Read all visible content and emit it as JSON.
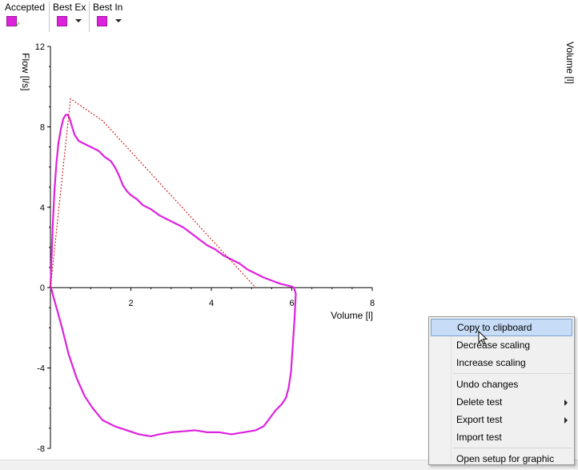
{
  "legend": {
    "items": [
      {
        "label": "Accepted",
        "color": "#dd22dd",
        "icon": "checkmark-icon"
      },
      {
        "label": "Best Ex",
        "color": "#dd22dd",
        "icon": "dropdown-arrow-icon"
      },
      {
        "label": "Best In",
        "color": "#dd22dd",
        "icon": "dropdown-arrow-icon"
      }
    ]
  },
  "right_axis_label": "Volume [l]",
  "chart_data": {
    "type": "line",
    "xlabel": "Volume [l]",
    "ylabel": "Flow [l/s]",
    "xlim": [
      0,
      8
    ],
    "ylim": [
      -8,
      12
    ],
    "x_ticks": [
      "2",
      "4",
      "6",
      "8"
    ],
    "y_ticks": [
      "12",
      "8",
      "4",
      "0",
      "-4",
      "-8"
    ],
    "grid": false,
    "series": [
      {
        "style": "solid",
        "color": "#dd22dd",
        "x": [
          0,
          0.03,
          0.06,
          0.1,
          0.15,
          0.2,
          0.26,
          0.32,
          0.38,
          0.43,
          0.48,
          0.54,
          0.6,
          0.7,
          0.8,
          0.9,
          1.0,
          1.2,
          1.35,
          1.5,
          1.6,
          1.7,
          1.8,
          1.9,
          2.0,
          2.15,
          2.3,
          2.5,
          2.7,
          2.9,
          3.1,
          3.3,
          3.5,
          3.7,
          3.9,
          4.1,
          4.3,
          4.5,
          4.7,
          4.9,
          5.1,
          5.3,
          5.5,
          5.7,
          5.9,
          6.0,
          6.05,
          6.1,
          6.07,
          6.02,
          5.98,
          5.92,
          5.85,
          5.75,
          5.6,
          5.45,
          5.3,
          5.1,
          4.8,
          4.5,
          4.2,
          3.9,
          3.6,
          3.3,
          3.0,
          2.7,
          2.5,
          2.2,
          1.9,
          1.6,
          1.3,
          1.05,
          0.85,
          0.65,
          0.45,
          0.3,
          0.18,
          0.08,
          0.03,
          0
        ],
        "y": [
          0,
          1.6,
          3.2,
          4.8,
          6.2,
          7.2,
          7.9,
          8.4,
          8.6,
          8.6,
          8.4,
          8.0,
          7.6,
          7.3,
          7.2,
          7.1,
          7.0,
          6.8,
          6.5,
          6.3,
          6.0,
          5.6,
          5.1,
          4.8,
          4.6,
          4.4,
          4.1,
          3.9,
          3.6,
          3.4,
          3.2,
          3.0,
          2.7,
          2.4,
          2.1,
          1.9,
          1.6,
          1.4,
          1.2,
          0.9,
          0.7,
          0.5,
          0.35,
          0.2,
          0.1,
          0.05,
          0,
          -0.3,
          -1.5,
          -3.0,
          -4.2,
          -5.0,
          -5.5,
          -5.8,
          -6.1,
          -6.5,
          -6.9,
          -7.1,
          -7.2,
          -7.3,
          -7.2,
          -7.2,
          -7.1,
          -7.15,
          -7.2,
          -7.3,
          -7.4,
          -7.3,
          -7.1,
          -6.9,
          -6.6,
          -6.0,
          -5.4,
          -4.5,
          -3.3,
          -2.1,
          -1.2,
          -0.5,
          -0.1,
          0
        ]
      },
      {
        "style": "dotted",
        "color": "#cc0000",
        "x": [
          0,
          0.5,
          1.3,
          5.1
        ],
        "y": [
          0,
          9.4,
          8.3,
          0
        ]
      }
    ]
  },
  "context_menu": {
    "items": [
      {
        "label": "Copy to clipboard",
        "highlighted": true
      },
      {
        "label": "Decrease scaling"
      },
      {
        "label": "Increase scaling"
      },
      {
        "label": "Undo changes"
      },
      {
        "label": "Delete test",
        "submenu": true
      },
      {
        "label": "Export test",
        "submenu": true
      },
      {
        "label": "Import test"
      },
      {
        "label": "Open setup for graphic"
      }
    ]
  }
}
